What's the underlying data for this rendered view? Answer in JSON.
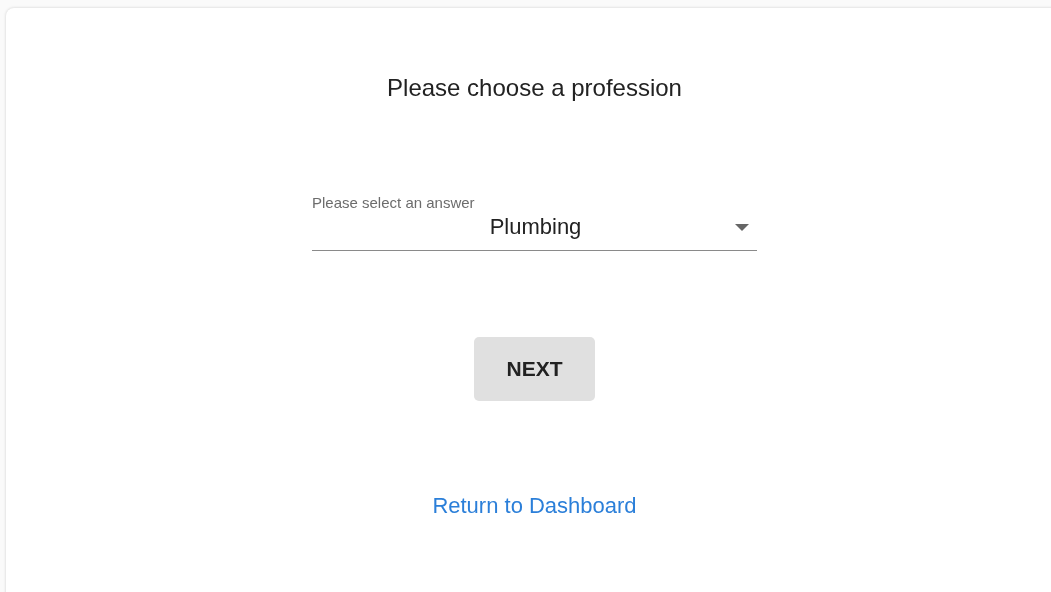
{
  "title": "Please choose a profession",
  "select": {
    "label": "Please select an answer",
    "value": "Plumbing"
  },
  "buttons": [
    {
      "label": "NEXT"
    }
  ],
  "link": {
    "label": "Return to Dashboard"
  }
}
